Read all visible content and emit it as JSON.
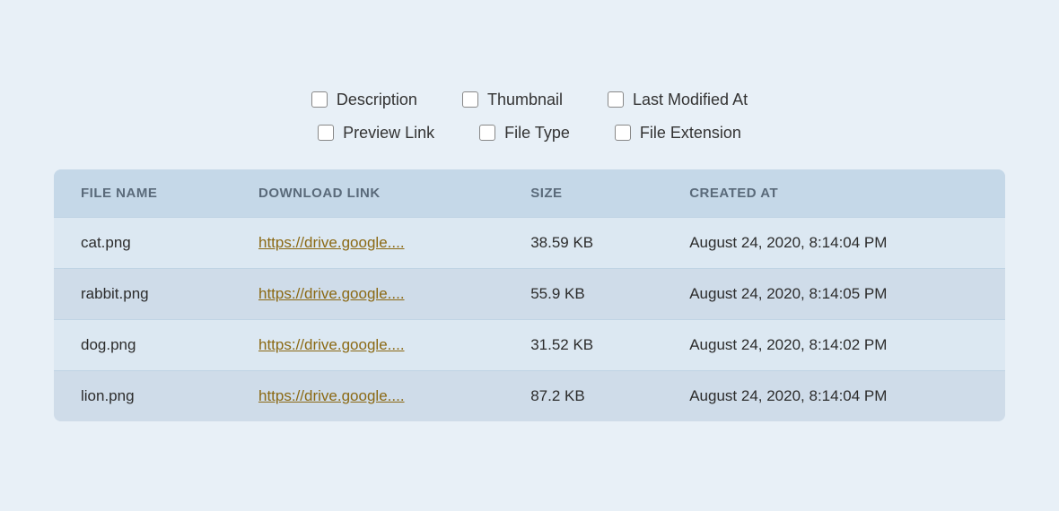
{
  "checkboxes": {
    "row1": [
      {
        "id": "description",
        "label": "Description",
        "checked": false
      },
      {
        "id": "thumbnail",
        "label": "Thumbnail",
        "checked": false
      },
      {
        "id": "last-modified-at",
        "label": "Last Modified At",
        "checked": false
      }
    ],
    "row2": [
      {
        "id": "preview-link",
        "label": "Preview Link",
        "checked": false
      },
      {
        "id": "file-type",
        "label": "File Type",
        "checked": false
      },
      {
        "id": "file-extension",
        "label": "File Extension",
        "checked": false
      }
    ]
  },
  "table": {
    "columns": [
      {
        "key": "file_name",
        "label": "FILE NAME"
      },
      {
        "key": "download_link",
        "label": "DOWNLOAD LINK"
      },
      {
        "key": "size",
        "label": "SIZE"
      },
      {
        "key": "created_at",
        "label": "CREATED AT"
      }
    ],
    "rows": [
      {
        "file_name": "cat.png",
        "download_link": "https://drive.google....",
        "size": "38.59 KB",
        "created_at": "August 24, 2020, 8:14:04 PM"
      },
      {
        "file_name": "rabbit.png",
        "download_link": "https://drive.google....",
        "size": "55.9 KB",
        "created_at": "August 24, 2020, 8:14:05 PM"
      },
      {
        "file_name": "dog.png",
        "download_link": "https://drive.google....",
        "size": "31.52 KB",
        "created_at": "August 24, 2020, 8:14:02 PM"
      },
      {
        "file_name": "lion.png",
        "download_link": "https://drive.google....",
        "size": "87.2 KB",
        "created_at": "August 24, 2020, 8:14:04 PM"
      }
    ]
  }
}
